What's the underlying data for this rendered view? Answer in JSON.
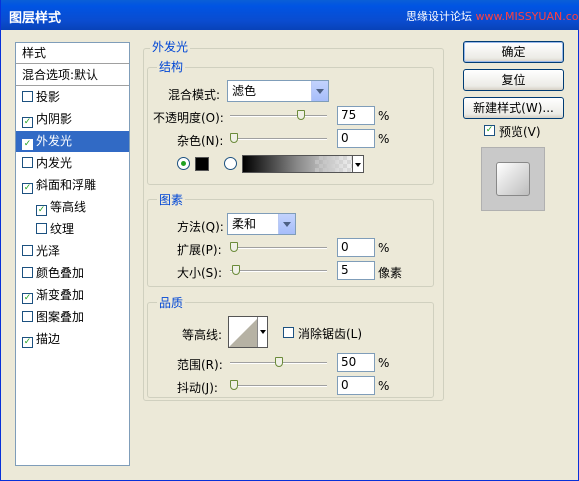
{
  "window": {
    "title": "图层样式",
    "watermark_prefix": "思缘设计论坛 ",
    "watermark_url": "www.MISSYUAN.com"
  },
  "styles_list": {
    "header": "样式",
    "blend": "混合选项:默认",
    "items": [
      {
        "label": "投影",
        "checked": false,
        "selected": false,
        "indent": false
      },
      {
        "label": "内阴影",
        "checked": true,
        "selected": false,
        "indent": false
      },
      {
        "label": "外发光",
        "checked": true,
        "selected": true,
        "indent": false
      },
      {
        "label": "内发光",
        "checked": false,
        "selected": false,
        "indent": false
      },
      {
        "label": "斜面和浮雕",
        "checked": true,
        "selected": false,
        "indent": false
      },
      {
        "label": "等高线",
        "checked": true,
        "selected": false,
        "indent": true
      },
      {
        "label": "纹理",
        "checked": false,
        "selected": false,
        "indent": true
      },
      {
        "label": "光泽",
        "checked": false,
        "selected": false,
        "indent": false
      },
      {
        "label": "颜色叠加",
        "checked": false,
        "selected": false,
        "indent": false
      },
      {
        "label": "渐变叠加",
        "checked": true,
        "selected": false,
        "indent": false
      },
      {
        "label": "图案叠加",
        "checked": false,
        "selected": false,
        "indent": false
      },
      {
        "label": "描边",
        "checked": true,
        "selected": false,
        "indent": false
      }
    ]
  },
  "panel": {
    "title": "外发光",
    "structure": {
      "title": "结构",
      "blend_mode_label": "混合模式:",
      "blend_mode_value": "滤色",
      "opacity_label": "不透明度(O):",
      "opacity_value": "75",
      "opacity_fraction": 0.75,
      "noise_label": "杂色(N):",
      "noise_value": "0",
      "noise_fraction": 0,
      "pct": "%",
      "color_mode": "solid",
      "color": "#000000"
    },
    "elements": {
      "title": "图素",
      "method_label": "方法(Q):",
      "method_value": "柔和",
      "spread_label": "扩展(P):",
      "spread_value": "0",
      "spread_fraction": 0,
      "size_label": "大小(S):",
      "size_value": "5",
      "size_fraction": 0.02,
      "pct": "%",
      "px": "像素"
    },
    "quality": {
      "title": "品质",
      "contour_label": "等高线:",
      "antialias_label": "消除锯齿(L)",
      "antialias_checked": false,
      "range_label": "范围(R):",
      "range_value": "50",
      "range_fraction": 0.5,
      "jitter_label": "抖动(J):",
      "jitter_value": "0",
      "jitter_fraction": 0,
      "pct": "%"
    }
  },
  "buttons": {
    "ok": "确定",
    "reset": "复位",
    "new_style": "新建样式(W)...",
    "preview_label": "预览(V)",
    "preview_checked": true
  },
  "colors": {
    "title_bar": "#0054e3",
    "selection": "#316ac5",
    "group_label": "#0046d5",
    "check": "#21a121"
  }
}
